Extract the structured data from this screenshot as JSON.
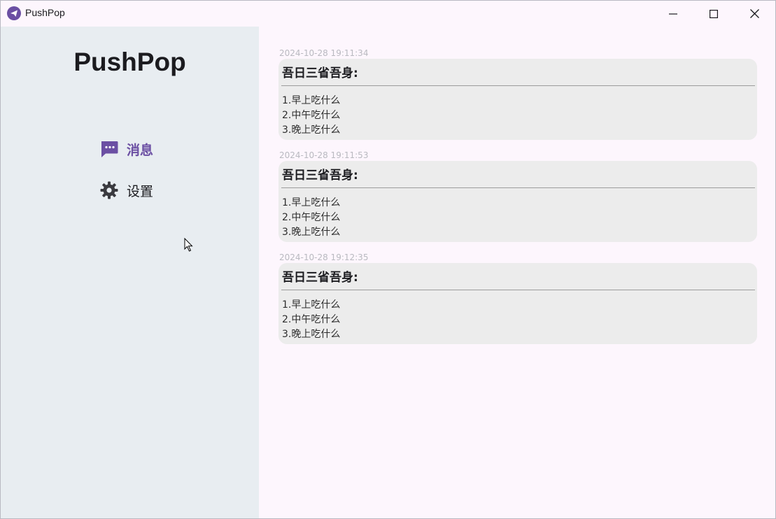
{
  "window": {
    "title": "PushPop"
  },
  "sidebar": {
    "brand": "PushPop",
    "items": [
      {
        "label": "消息",
        "icon": "chat-bubble-icon",
        "active": true
      },
      {
        "label": "设置",
        "icon": "gear-icon",
        "active": false
      }
    ]
  },
  "messages": [
    {
      "timestamp": "2024-10-28 19:11:34",
      "title": "吾日三省吾身:",
      "lines": [
        "1.早上吃什么",
        "2.中午吃什么",
        "3.晚上吃什么"
      ]
    },
    {
      "timestamp": "2024-10-28 19:11:53",
      "title": "吾日三省吾身:",
      "lines": [
        "1.早上吃什么",
        "2.中午吃什么",
        "3.晚上吃什么"
      ]
    },
    {
      "timestamp": "2024-10-28 19:12:35",
      "title": "吾日三省吾身:",
      "lines": [
        "1.早上吃什么",
        "2.中午吃什么",
        "3.晚上吃什么"
      ]
    }
  ],
  "colors": {
    "accent": "#6b4fa3",
    "sidebar_bg": "#e8edf1",
    "main_bg": "#fdf6fd",
    "card_bg": "#ececec"
  }
}
